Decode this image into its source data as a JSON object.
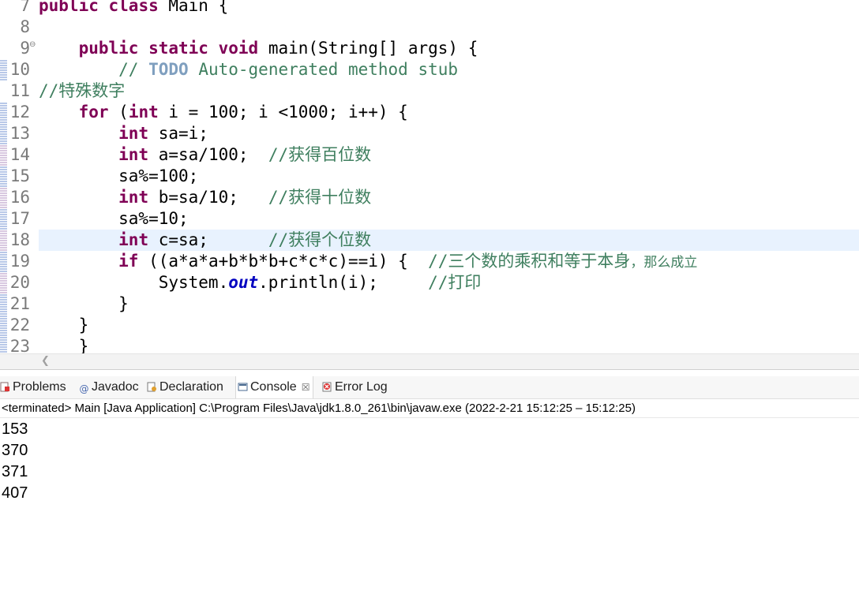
{
  "editor": {
    "lines": [
      {
        "n": "7",
        "code": [
          {
            "t": "kw",
            "v": "public"
          },
          {
            "t": "txt",
            "v": " "
          },
          {
            "t": "kw",
            "v": "class"
          },
          {
            "t": "txt",
            "v": " Main {"
          }
        ]
      },
      {
        "n": "8",
        "code": []
      },
      {
        "n": "9",
        "fold": "⊖",
        "code": [
          {
            "t": "txt",
            "v": "    "
          },
          {
            "t": "kw",
            "v": "public"
          },
          {
            "t": "txt",
            "v": " "
          },
          {
            "t": "kw",
            "v": "static"
          },
          {
            "t": "txt",
            "v": " "
          },
          {
            "t": "kw",
            "v": "void"
          },
          {
            "t": "txt",
            "v": " main(String[] args) {"
          }
        ]
      },
      {
        "n": "10",
        "code": [
          {
            "t": "txt",
            "v": "        "
          },
          {
            "t": "cm",
            "v": "// "
          },
          {
            "t": "todo",
            "v": "TODO"
          },
          {
            "t": "cm",
            "v": " Auto-generated method stub"
          }
        ]
      },
      {
        "n": "11",
        "code": [
          {
            "t": "cm",
            "v": "//特殊数字"
          }
        ]
      },
      {
        "n": "12",
        "code": [
          {
            "t": "txt",
            "v": "    "
          },
          {
            "t": "kw",
            "v": "for"
          },
          {
            "t": "txt",
            "v": " ("
          },
          {
            "t": "kw",
            "v": "int"
          },
          {
            "t": "txt",
            "v": " i = 100; i <1000; i++) {"
          }
        ]
      },
      {
        "n": "13",
        "code": [
          {
            "t": "txt",
            "v": "        "
          },
          {
            "t": "kw",
            "v": "int"
          },
          {
            "t": "txt",
            "v": " sa=i;"
          }
        ]
      },
      {
        "n": "14",
        "code": [
          {
            "t": "txt",
            "v": "        "
          },
          {
            "t": "kw",
            "v": "int"
          },
          {
            "t": "txt",
            "v": " a=sa/100;  "
          },
          {
            "t": "cm",
            "v": "//获得百位数"
          }
        ]
      },
      {
        "n": "15",
        "code": [
          {
            "t": "txt",
            "v": "        sa%=100;"
          }
        ]
      },
      {
        "n": "16",
        "code": [
          {
            "t": "txt",
            "v": "        "
          },
          {
            "t": "kw",
            "v": "int"
          },
          {
            "t": "txt",
            "v": " b=sa/10;   "
          },
          {
            "t": "cm",
            "v": "//获得十位数"
          }
        ]
      },
      {
        "n": "17",
        "code": [
          {
            "t": "txt",
            "v": "        sa%=10;"
          }
        ]
      },
      {
        "n": "18",
        "hl": true,
        "code": [
          {
            "t": "txt",
            "v": "        "
          },
          {
            "t": "kw",
            "v": "int"
          },
          {
            "t": "txt",
            "v": " c=sa;      "
          },
          {
            "t": "cm",
            "v": "//获得个位数"
          }
        ]
      },
      {
        "n": "19",
        "code": [
          {
            "t": "txt",
            "v": "        "
          },
          {
            "t": "kw",
            "v": "if"
          },
          {
            "t": "txt",
            "v": " ((a*a*a+b*b*b+c*c*c)==i) {  "
          },
          {
            "t": "cm",
            "v": "//三个数的乘积和等于本身"
          },
          {
            "t": "cms",
            "v": "，那么成立"
          }
        ]
      },
      {
        "n": "20",
        "code": [
          {
            "t": "txt",
            "v": "            System."
          },
          {
            "t": "fld",
            "v": "out"
          },
          {
            "t": "txt",
            "v": ".println(i);     "
          },
          {
            "t": "cm",
            "v": "//打印"
          }
        ]
      },
      {
        "n": "21",
        "code": [
          {
            "t": "txt",
            "v": "        }"
          }
        ]
      },
      {
        "n": "22",
        "code": [
          {
            "t": "txt",
            "v": "    }"
          }
        ]
      },
      {
        "n": "23",
        "code": [
          {
            "t": "txt",
            "v": "    }"
          }
        ]
      }
    ]
  },
  "views": {
    "tabs": [
      {
        "label": "Problems",
        "icon": "problems-icon"
      },
      {
        "label": "Javadoc",
        "icon": "javadoc-icon"
      },
      {
        "label": "Declaration",
        "icon": "declaration-icon"
      },
      {
        "label": "Console",
        "icon": "console-icon",
        "active": true,
        "close": "☒"
      },
      {
        "label": "Error Log",
        "icon": "error-log-icon"
      }
    ],
    "status": "<terminated> Main [Java Application] C:\\Program Files\\Java\\jdk1.8.0_261\\bin\\javaw.exe  (2022-2-21 15:12:25 – 15:12:25)",
    "output": [
      "153",
      "370",
      "371",
      "407"
    ]
  },
  "colors": {
    "keyword": "#7f0055",
    "comment": "#3f7f5f",
    "todo": "#7f9fbf",
    "field": "#0000c0",
    "highlight": "#e8f2fe"
  }
}
